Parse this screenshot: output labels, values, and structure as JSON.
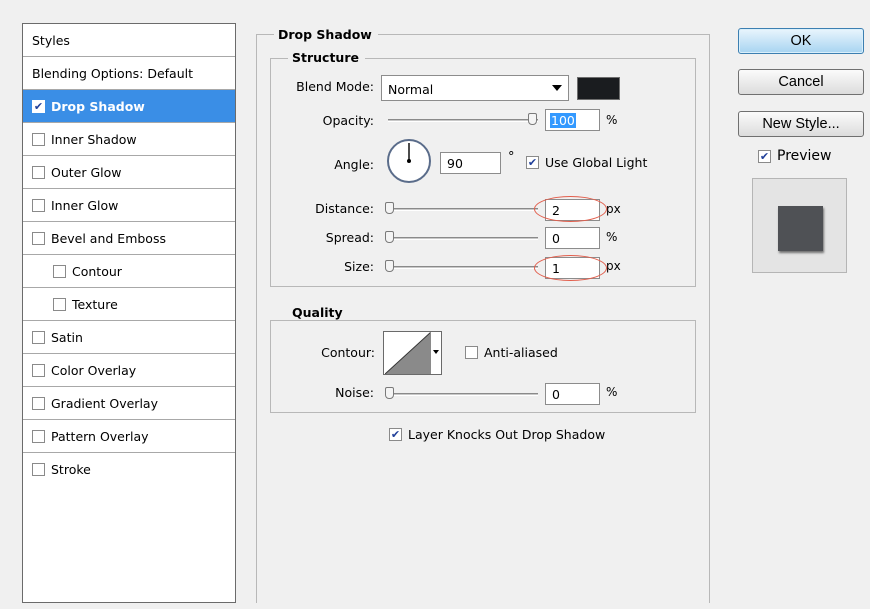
{
  "styles_panel": {
    "header": "Styles",
    "blending_options": "Blending Options: Default",
    "items": [
      {
        "label": "Drop Shadow",
        "checked": true,
        "selected": true
      },
      {
        "label": "Inner Shadow",
        "checked": false
      },
      {
        "label": "Outer Glow",
        "checked": false
      },
      {
        "label": "Inner Glow",
        "checked": false
      },
      {
        "label": "Bevel and Emboss",
        "checked": false
      },
      {
        "label": "Contour",
        "checked": false,
        "sub": true
      },
      {
        "label": "Texture",
        "checked": false,
        "sub": true
      },
      {
        "label": "Satin",
        "checked": false
      },
      {
        "label": "Color Overlay",
        "checked": false
      },
      {
        "label": "Gradient Overlay",
        "checked": false
      },
      {
        "label": "Pattern Overlay",
        "checked": false
      },
      {
        "label": "Stroke",
        "checked": false
      }
    ]
  },
  "drop_shadow": {
    "title": "Drop Shadow",
    "structure": {
      "title": "Structure",
      "blend_mode_label": "Blend Mode:",
      "blend_mode_value": "Normal",
      "shadow_color": "#1a1c1f",
      "opacity_label": "Opacity:",
      "opacity_value": "100",
      "opacity_unit": "%",
      "opacity_fraction": 1.0,
      "angle_label": "Angle:",
      "angle_value": "90",
      "angle_unit": "°",
      "use_global_light_label": "Use Global Light",
      "use_global_light_checked": true,
      "distance_label": "Distance:",
      "distance_value": "2",
      "distance_unit": "px",
      "spread_label": "Spread:",
      "spread_value": "0",
      "spread_unit": "%",
      "size_label": "Size:",
      "size_value": "1",
      "size_unit": "px"
    },
    "quality": {
      "title": "Quality",
      "contour_label": "Contour:",
      "anti_aliased_label": "Anti-aliased",
      "anti_aliased_checked": false,
      "noise_label": "Noise:",
      "noise_value": "0",
      "noise_unit": "%"
    },
    "layer_knocks_out_label": "Layer Knocks Out Drop Shadow",
    "layer_knocks_out_checked": true
  },
  "buttons": {
    "ok": "OK",
    "cancel": "Cancel",
    "new_style": "New Style..."
  },
  "preview": {
    "label": "Preview",
    "checked": true,
    "swatch_color": "#4f5155"
  },
  "colors": {
    "selection": "#3a8ee6",
    "annotation": "#e25e4c"
  }
}
